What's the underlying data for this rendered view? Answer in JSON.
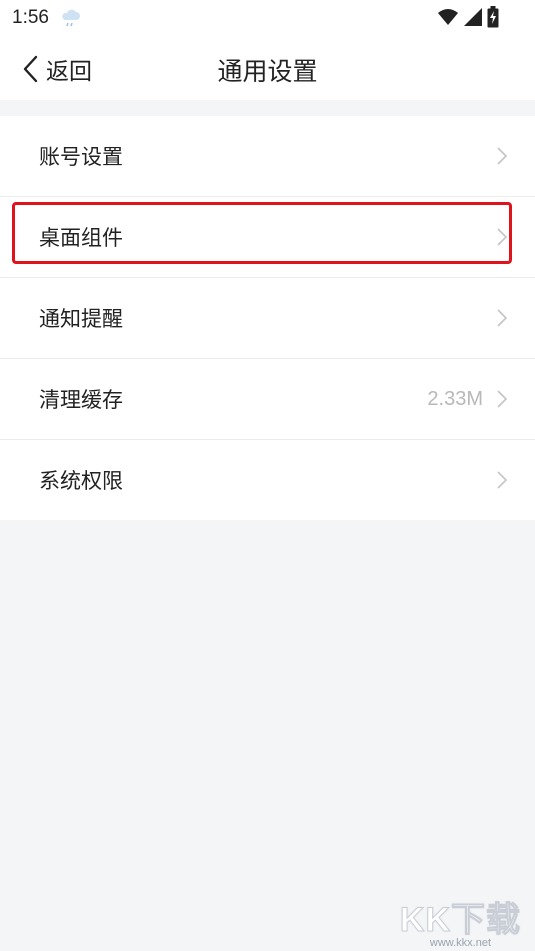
{
  "status_bar": {
    "time": "1:56",
    "weather_icon": "cloud-rain-icon",
    "icons": [
      "wifi-icon",
      "signal-icon",
      "battery-charging-icon"
    ]
  },
  "header": {
    "back_label": "返回",
    "title": "通用设置"
  },
  "settings": {
    "items": [
      {
        "label": "账号设置",
        "value": ""
      },
      {
        "label": "桌面组件",
        "value": ""
      },
      {
        "label": "通知提醒",
        "value": ""
      },
      {
        "label": "清理缓存",
        "value": "2.33M"
      },
      {
        "label": "系统权限",
        "value": ""
      }
    ]
  },
  "colors": {
    "background": "#f4f5f7",
    "highlight": "#e0121b",
    "chevron": "#c4c4c4"
  },
  "watermark": {
    "logo": "KK下载",
    "url": "www.kkx.net"
  }
}
